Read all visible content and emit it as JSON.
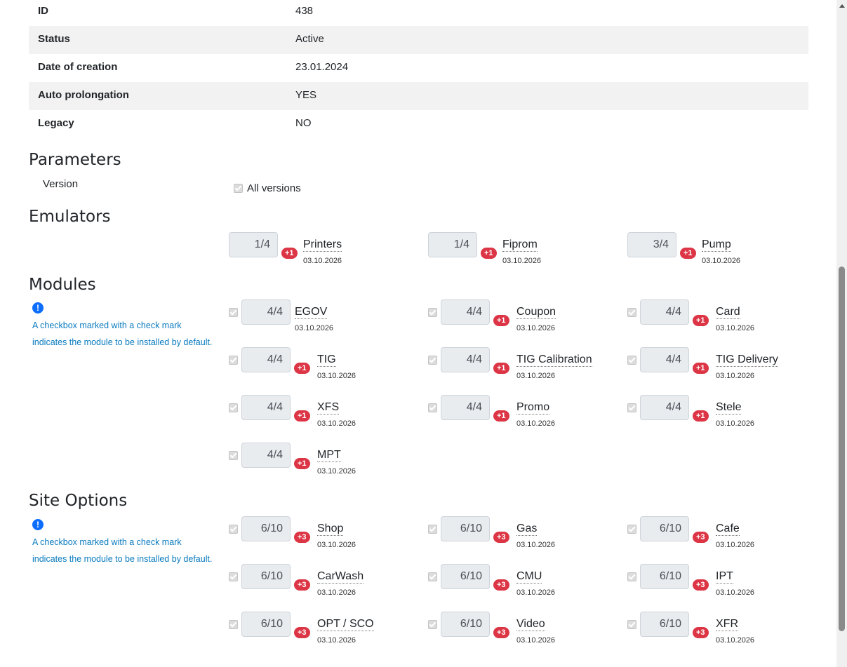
{
  "info": [
    {
      "key": "ID",
      "value": "438"
    },
    {
      "key": "Status",
      "value": "Active"
    },
    {
      "key": "Date of creation",
      "value": "23.01.2024"
    },
    {
      "key": "Auto prolongation",
      "value": "YES"
    },
    {
      "key": "Legacy",
      "value": "NO"
    }
  ],
  "parameters": {
    "title": "Parameters",
    "version_label": "Version",
    "all_versions_label": "All versions"
  },
  "emulators": {
    "title": "Emulators",
    "items": [
      {
        "qty": "1/4",
        "badge": "+1",
        "name": "Printers",
        "date": "03.10.2026"
      },
      {
        "qty": "1/4",
        "badge": "+1",
        "name": "Fiprom",
        "date": "03.10.2026"
      },
      {
        "qty": "3/4",
        "badge": "+1",
        "name": "Pump",
        "date": "03.10.2026"
      }
    ]
  },
  "modules": {
    "title": "Modules",
    "hint_line1": "A checkbox marked with a check mark",
    "hint_line2": "indicates the module to be installed by default.",
    "items": [
      {
        "qty": "4/4",
        "badge": "",
        "name": "EGOV",
        "date": "03.10.2026"
      },
      {
        "qty": "4/4",
        "badge": "+1",
        "name": "Coupon",
        "date": "03.10.2026"
      },
      {
        "qty": "4/4",
        "badge": "+1",
        "name": "Card",
        "date": "03.10.2026"
      },
      {
        "qty": "4/4",
        "badge": "+1",
        "name": "TIG",
        "date": "03.10.2026"
      },
      {
        "qty": "4/4",
        "badge": "+1",
        "name": "TIG Calibration",
        "date": "03.10.2026"
      },
      {
        "qty": "4/4",
        "badge": "+1",
        "name": "TIG Delivery",
        "date": "03.10.2026"
      },
      {
        "qty": "4/4",
        "badge": "+1",
        "name": "XFS",
        "date": "03.10.2026"
      },
      {
        "qty": "4/4",
        "badge": "+1",
        "name": "Promo",
        "date": "03.10.2026"
      },
      {
        "qty": "4/4",
        "badge": "+1",
        "name": "Stele",
        "date": "03.10.2026"
      },
      {
        "qty": "4/4",
        "badge": "+1",
        "name": "MPT",
        "date": "03.10.2026"
      }
    ]
  },
  "site_options": {
    "title": "Site Options",
    "hint_line1": "A checkbox marked with a check mark",
    "hint_line2": "indicates the module to be installed by default.",
    "items": [
      {
        "qty": "6/10",
        "badge": "+3",
        "name": "Shop",
        "date": "03.10.2026"
      },
      {
        "qty": "6/10",
        "badge": "+3",
        "name": "Gas",
        "date": "03.10.2026"
      },
      {
        "qty": "6/10",
        "badge": "+3",
        "name": "Cafe",
        "date": "03.10.2026"
      },
      {
        "qty": "6/10",
        "badge": "+3",
        "name": "CarWash",
        "date": "03.10.2026"
      },
      {
        "qty": "6/10",
        "badge": "+3",
        "name": "CMU",
        "date": "03.10.2026"
      },
      {
        "qty": "6/10",
        "badge": "+3",
        "name": "IPT",
        "date": "03.10.2026"
      },
      {
        "qty": "6/10",
        "badge": "+3",
        "name": "OPT / SCO",
        "date": "03.10.2026"
      },
      {
        "qty": "6/10",
        "badge": "+3",
        "name": "Video",
        "date": "03.10.2026"
      },
      {
        "qty": "6/10",
        "badge": "+3",
        "name": "XFR",
        "date": "03.10.2026"
      }
    ]
  },
  "icons": {
    "info": "info-circle-icon",
    "checkbox": "check-icon"
  },
  "colors": {
    "badge": "#dc3545",
    "hint": "#0a7bbf",
    "info_icon": "#0d6efd"
  }
}
